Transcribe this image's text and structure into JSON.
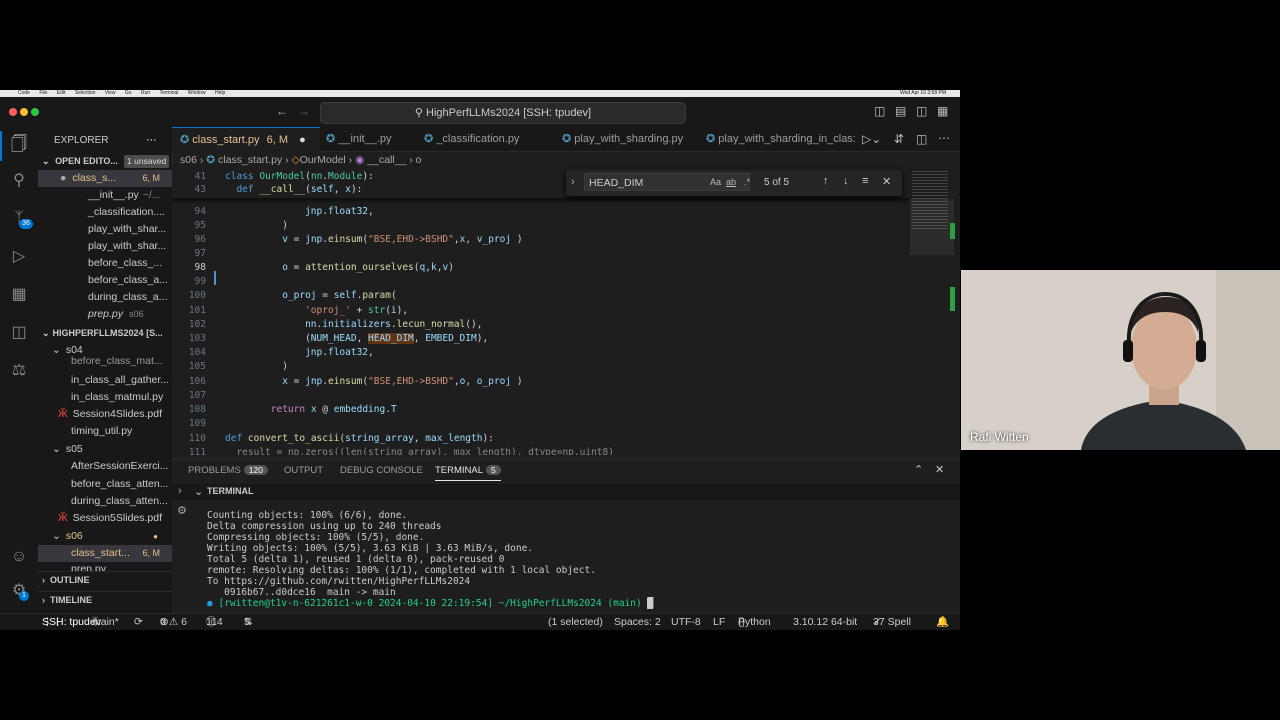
{
  "mac_menubar": {
    "items": [
      "Code",
      "File",
      "Edit",
      "Selection",
      "View",
      "Go",
      "Run",
      "Terminal",
      "Window",
      "Help"
    ],
    "clock": "Wed Apr 10 3:58 PM"
  },
  "titlebar": {
    "search_text": "HighPerfLLMs2024 [SSH: tpudev]"
  },
  "activity": {
    "source_control_badge": "36",
    "settings_badge": "1"
  },
  "sidebar": {
    "title": "EXPLORER",
    "open_editors_label": "OPEN EDITO...",
    "unsaved_badge": "1 unsaved",
    "open_editors": [
      {
        "name": "class_s...",
        "status": "6, M",
        "modified": true
      },
      {
        "name": "__init__.py",
        "status": "~/...",
        "modified": false
      },
      {
        "name": "_classification....",
        "status": "",
        "modified": false
      },
      {
        "name": "play_with_shar...",
        "status": "",
        "modified": false
      },
      {
        "name": "play_with_shar...",
        "status": "",
        "modified": false
      },
      {
        "name": "before_class_...",
        "status": "",
        "modified": false
      },
      {
        "name": "before_class_a...",
        "status": "",
        "modified": false
      },
      {
        "name": "during_class_a...",
        "status": "",
        "modified": false
      },
      {
        "name": "prep.py",
        "status": "s06",
        "modified": false
      }
    ],
    "project_label": "HIGHPERFLLMS2024 [S...",
    "s04_label": "s04",
    "s04_items": [
      "before_class_mat...",
      "in_class_all_gather...",
      "in_class_matmul.py",
      "Session4Slides.pdf",
      "timing_util.py"
    ],
    "s05_label": "s05",
    "s05_items": [
      "AfterSessionExerci...",
      "before_class_atten...",
      "during_class_atten...",
      "Session5Slides.pdf"
    ],
    "s06_label": "s06",
    "s06_items": [
      {
        "name": "class_start...",
        "status": "6, M"
      },
      {
        "name": "prep.py",
        "status": ""
      }
    ],
    "outline_label": "OUTLINE",
    "timeline_label": "TIMELINE"
  },
  "tabs": [
    {
      "label": "class_start.py",
      "status": "6, M",
      "active": true
    },
    {
      "label": "__init__.py",
      "active": false
    },
    {
      "label": "_classification.py",
      "active": false
    },
    {
      "label": "play_with_sharding.py",
      "active": false
    },
    {
      "label": "play_with_sharding_in_clas:",
      "active": false
    }
  ],
  "breadcrumbs": [
    "s06",
    "class_start.py",
    "OurModel",
    "__call__",
    "o"
  ],
  "find": {
    "query": "HEAD_DIM",
    "options": [
      "Aa",
      "ab",
      ".*"
    ],
    "result": "5 of 5"
  },
  "code": {
    "sticky": [
      {
        "n": "41",
        "text": "class OurModel(nn.Module):"
      },
      {
        "n": "43",
        "text": "  def __call__(self, x):"
      }
    ],
    "lines": [
      {
        "n": "94",
        "text": "              jnp.float32,"
      },
      {
        "n": "95",
        "text": "          )"
      },
      {
        "n": "96",
        "text": "          v = jnp.einsum(\"BSE,EHD->BSHD\",x, v_proj )"
      },
      {
        "n": "97",
        "text": ""
      },
      {
        "n": "98",
        "text": "          o = attention_ourselves(q,k,v)"
      },
      {
        "n": "99",
        "text": ""
      },
      {
        "n": "100",
        "text": "          o_proj = self.param("
      },
      {
        "n": "101",
        "text": "              'oproj_' + str(i),"
      },
      {
        "n": "102",
        "text": "              nn.initializers.lecun_normal(),"
      },
      {
        "n": "103",
        "text": "              (NUM_HEAD, HEAD_DIM, EMBED_DIM),"
      },
      {
        "n": "104",
        "text": "              jnp.float32,"
      },
      {
        "n": "105",
        "text": "          )"
      },
      {
        "n": "106",
        "text": "          x = jnp.einsum(\"BSE,EHD->BSHD\",o, o_proj )"
      },
      {
        "n": "107",
        "text": ""
      },
      {
        "n": "108",
        "text": "        return x @ embedding.T"
      },
      {
        "n": "109",
        "text": ""
      },
      {
        "n": "110",
        "text": "def convert_to_ascii(string_array, max_length):"
      },
      {
        "n": "111",
        "text": "  result = np.zeros((len(string_array), max_length), dtype=np.uint8)"
      }
    ]
  },
  "panel": {
    "tabs": [
      {
        "label": "PROBLEMS",
        "badge": "120"
      },
      {
        "label": "OUTPUT",
        "badge": ""
      },
      {
        "label": "DEBUG CONSOLE",
        "badge": ""
      },
      {
        "label": "TERMINAL",
        "badge": "5"
      }
    ],
    "terminal_title": "TERMINAL",
    "terminal_lines": [
      "Counting objects: 100% (6/6), done.",
      "Delta compression using up to 240 threads",
      "Compressing objects: 100% (5/5), done.",
      "Writing objects: 100% (5/5), 3.63 KiB | 3.63 MiB/s, done.",
      "Total 5 (delta 1), reused 1 (delta 0), pack-reused 0",
      "remote: Resolving deltas: 100% (1/1), completed with 1 local object.",
      "To https://github.com/rwitten/HighPerfLLMs2024",
      "   0916b67..d0dce16  main -> main"
    ],
    "prompt": "[rwitten@t1v-n-621261c1-w-0 2024-04-10 22:19:54] ~/HighPerfLLMs2024 (main) "
  },
  "statusbar": {
    "remote": "SSH: tpudev",
    "branch": "main*",
    "problems": "0 ⚠ 6",
    "info": "114",
    "ports": "5",
    "selection": "(1 selected)",
    "spaces": "Spaces: 2",
    "encoding": "UTF-8",
    "eol": "LF",
    "language": "Python",
    "interpreter": "3.10.12 64-bit",
    "spell": "37 Spell"
  },
  "webcam": {
    "name": "Rafi Witten"
  }
}
